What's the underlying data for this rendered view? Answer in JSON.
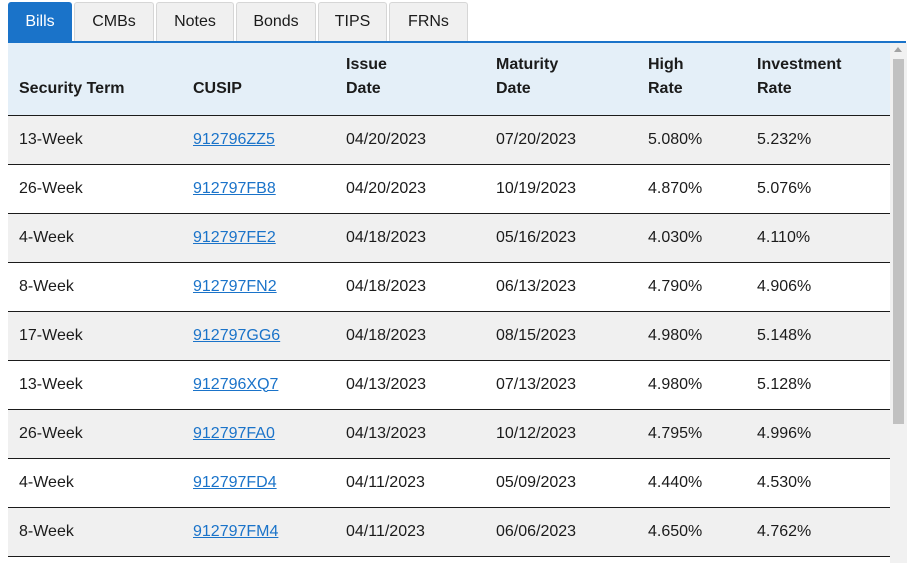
{
  "tabs": [
    {
      "label": "Bills",
      "active": true
    },
    {
      "label": "CMBs",
      "active": false
    },
    {
      "label": "Notes",
      "active": false
    },
    {
      "label": "Bonds",
      "active": false
    },
    {
      "label": "TIPS",
      "active": false
    },
    {
      "label": "FRNs",
      "active": false
    }
  ],
  "colors": {
    "accent": "#1a73c9",
    "header_bg": "#e4eff8",
    "row_stripe": "#f0f0f0"
  },
  "table": {
    "headers": {
      "term": "Security Term",
      "cusip": "CUSIP",
      "issue_line1": "Issue",
      "issue_line2": "Date",
      "maturity_line1": "Maturity",
      "maturity_line2": "Date",
      "high_line1": "High",
      "high_line2": "Rate",
      "invest_line1": "Investment",
      "invest_line2": "Rate"
    },
    "rows": [
      {
        "term": "13-Week",
        "cusip": "912796ZZ5",
        "issue": "04/20/2023",
        "maturity": "07/20/2023",
        "high": "5.080%",
        "invest": "5.232%"
      },
      {
        "term": "26-Week",
        "cusip": "912797FB8",
        "issue": "04/20/2023",
        "maturity": "10/19/2023",
        "high": "4.870%",
        "invest": "5.076%"
      },
      {
        "term": "4-Week",
        "cusip": "912797FE2",
        "issue": "04/18/2023",
        "maturity": "05/16/2023",
        "high": "4.030%",
        "invest": "4.110%"
      },
      {
        "term": "8-Week",
        "cusip": "912797FN2",
        "issue": "04/18/2023",
        "maturity": "06/13/2023",
        "high": "4.790%",
        "invest": "4.906%"
      },
      {
        "term": "17-Week",
        "cusip": "912797GG6",
        "issue": "04/18/2023",
        "maturity": "08/15/2023",
        "high": "4.980%",
        "invest": "5.148%"
      },
      {
        "term": "13-Week",
        "cusip": "912796XQ7",
        "issue": "04/13/2023",
        "maturity": "07/13/2023",
        "high": "4.980%",
        "invest": "5.128%"
      },
      {
        "term": "26-Week",
        "cusip": "912797FA0",
        "issue": "04/13/2023",
        "maturity": "10/12/2023",
        "high": "4.795%",
        "invest": "4.996%"
      },
      {
        "term": "4-Week",
        "cusip": "912797FD4",
        "issue": "04/11/2023",
        "maturity": "05/09/2023",
        "high": "4.440%",
        "invest": "4.530%"
      },
      {
        "term": "8-Week",
        "cusip": "912797FM4",
        "issue": "04/11/2023",
        "maturity": "06/06/2023",
        "high": "4.650%",
        "invest": "4.762%"
      }
    ]
  }
}
